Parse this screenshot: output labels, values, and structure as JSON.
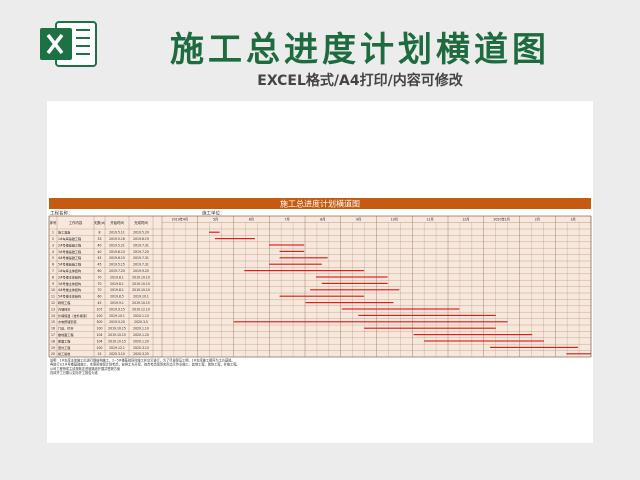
{
  "header": {
    "title": "施工总进度计划横道图",
    "subtitle": "EXCEL格式/A4打印/内容可修改"
  },
  "sheet": {
    "banner_title": "施工总进度计划横道图",
    "info_left": "工程名称：",
    "info_right": "施工单位：",
    "col_headers": [
      "序号",
      "工作内容",
      "天数(d)",
      "开始时间",
      "完成时间"
    ],
    "months": [
      "2019年4月",
      "5月",
      "6月",
      "7月",
      "8月",
      "9月",
      "10月",
      "11月",
      "12月",
      "2020年1月",
      "2月",
      "3月"
    ],
    "rows": [
      {
        "no": "1",
        "task": "施工准备",
        "days": "8",
        "start": "2019.5.11",
        "end": "2019.5.20"
      },
      {
        "no": "2",
        "task": "1#车库基础工程",
        "days": "33",
        "start": "2019.5.16",
        "end": "2019.6.19"
      },
      {
        "no": "3",
        "task": "2#号楼基础工程",
        "days": "40",
        "start": "2019.5.21",
        "end": "2019.7.31"
      },
      {
        "no": "4",
        "task": "3#号楼基础工程",
        "days": "40",
        "start": "2019.6.10",
        "end": "2019.7.20"
      },
      {
        "no": "5",
        "task": "4#号楼基础工程",
        "days": "45",
        "start": "2019.6.15",
        "end": "2019.7.31"
      },
      {
        "no": "6",
        "task": "5#号楼基础工程",
        "days": "45",
        "start": "2019.5.15",
        "end": "2019.7.31"
      },
      {
        "no": "7",
        "task": "1#车库主体结构",
        "days": "60",
        "start": "2019.7.20",
        "end": "2019.9.20"
      },
      {
        "no": "8",
        "task": "2#号楼主体结构",
        "days": "70",
        "start": "2019.8.1",
        "end": "2019.10.10"
      },
      {
        "no": "9",
        "task": "3#号楼主体结构",
        "days": "70",
        "start": "2019.8.1",
        "end": "2019.10.10"
      },
      {
        "no": "10",
        "task": "4#号楼主体结构",
        "days": "70",
        "start": "2019.8.1",
        "end": "2019.10.10"
      },
      {
        "no": "11",
        "task": "5#号楼主体结构",
        "days": "60",
        "start": "2019.8.5",
        "end": "2019.10.1"
      },
      {
        "no": "12",
        "task": "砌筑工程",
        "days": "45",
        "start": "2019.9.1",
        "end": "2019.10.15"
      },
      {
        "no": "13",
        "task": "内墙抹灰",
        "days": "107",
        "start": "2019.9.15",
        "end": "2019.12.10"
      },
      {
        "no": "14",
        "task": "外墙保温（含外墙漆）",
        "days": "100",
        "start": "2019.10.1",
        "end": "2020.1.10"
      },
      {
        "no": "15",
        "task": "水电预埋安装",
        "days": "300",
        "start": "2019.5.20",
        "end": "2020.3.5"
      },
      {
        "no": "16",
        "task": "门窗、栏杆",
        "days": "100",
        "start": "2019.10.15",
        "end": "2020.1.10"
      },
      {
        "no": "17",
        "task": "楼地面工程",
        "days": "104",
        "start": "2019.10.15",
        "end": "2020.1.20"
      },
      {
        "no": "18",
        "task": "屋面工程",
        "days": "104",
        "start": "2019.10.15",
        "end": "2020.1.20"
      },
      {
        "no": "19",
        "task": "室外工程",
        "days": "100",
        "start": "2019.12.1",
        "end": "2020.3.10"
      },
      {
        "no": "20",
        "task": "竣工验收",
        "days": "15",
        "start": "2020.3.10",
        "end": "2020.3.25"
      }
    ],
    "notes": [
      "说明：1#车库主体施工后进行钢结构施工，2~5#楼基础同时施工并交叉进行，为了尽量保证工期，1#车库施工顺序为土方基础。",
      "再进行以1#号楼基础施工，本案暂按现计划考虑，安排土方开挖，综合考虑现场实际交叉作业施工。其他工程，装饰工程，并按工程。",
      "公司工程桥成主线按既定进度路线开展并签署方案",
      "具体开工日期以实际开工报告为准"
    ]
  },
  "chart_data": {
    "type": "gantt",
    "title": "施工总进度计划横道图",
    "axis_start": "2019-04-01",
    "axis_end": "2020-03-31",
    "tasks": [
      {
        "name": "施工准备",
        "start": "2019-05-11",
        "end": "2019-05-20"
      },
      {
        "name": "1#车库基础工程",
        "start": "2019-05-16",
        "end": "2019-06-19"
      },
      {
        "name": "2#号楼基础工程",
        "start": "2019-07-01",
        "end": "2019-07-31"
      },
      {
        "name": "3#号楼基础工程",
        "start": "2019-07-10",
        "end": "2019-07-31"
      },
      {
        "name": "4#号楼基础工程",
        "start": "2019-07-10",
        "end": "2019-08-20"
      },
      {
        "name": "5#号楼基础工程",
        "start": "2019-07-01",
        "end": "2019-08-15"
      },
      {
        "name": "1#车库主体结构",
        "start": "2019-06-10",
        "end": "2019-09-20"
      },
      {
        "name": "2#号楼主体结构",
        "start": "2019-08-10",
        "end": "2019-10-10"
      },
      {
        "name": "3#号楼主体结构",
        "start": "2019-08-15",
        "end": "2019-10-10"
      },
      {
        "name": "4#号楼主体结构",
        "start": "2019-08-05",
        "end": "2019-10-20"
      },
      {
        "name": "5#号楼主体结构",
        "start": "2019-07-10",
        "end": "2019-09-20"
      },
      {
        "name": "砌筑工程",
        "start": "2019-08-01",
        "end": "2019-10-15"
      },
      {
        "name": "内墙抹灰",
        "start": "2019-09-01",
        "end": "2019-12-10"
      },
      {
        "name": "外墙保温（含外墙漆）",
        "start": "2019-09-15",
        "end": "2020-01-10"
      },
      {
        "name": "水电预埋安装",
        "start": "2019-06-01",
        "end": "2020-01-20"
      },
      {
        "name": "门窗、栏杆",
        "start": "2019-09-20",
        "end": "2020-01-10"
      },
      {
        "name": "楼地面工程",
        "start": "2019-11-01",
        "end": "2020-02-10"
      },
      {
        "name": "屋面工程",
        "start": "2019-11-10",
        "end": "2020-02-20"
      },
      {
        "name": "室外工程",
        "start": "2020-01-05",
        "end": "2020-03-20"
      },
      {
        "name": "竣工验收",
        "start": "2020-03-10",
        "end": "2020-03-31"
      }
    ]
  },
  "colors": {
    "title_green": "#1d6b3f",
    "banner": "#c55a11",
    "bar": "#e02020",
    "grid_bg": "#f8e8dc",
    "excel_green": "#1e7145"
  }
}
